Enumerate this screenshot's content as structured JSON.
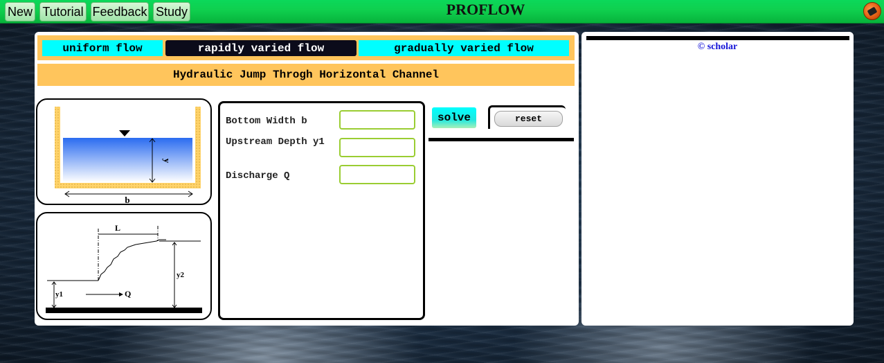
{
  "topbar": {
    "app_title": "PROFLOW",
    "nav": [
      "New",
      "Tutorial",
      "Feedback",
      "Study"
    ],
    "logout_icon": "logout-icon"
  },
  "tabs": [
    {
      "label": "uniform flow",
      "active": false
    },
    {
      "label": "rapidly varied flow",
      "active": true
    },
    {
      "label": "gradually varied flow",
      "active": false
    }
  ],
  "heading": "Hydraulic Jump Throgh Horizontal Channel",
  "diagram_cross_section": {
    "depth_label": "y",
    "width_label": "b"
  },
  "diagram_jump": {
    "length_label": "L",
    "y1_label": "y1",
    "y2_label": "y2",
    "discharge_label": "Q"
  },
  "form": {
    "fields": [
      {
        "label": "Bottom Width b",
        "value": ""
      },
      {
        "label": "Upstream Depth y1",
        "value": ""
      },
      {
        "label": "Discharge Q",
        "value": ""
      }
    ],
    "solve_label": "solve",
    "reset_label": "reset"
  },
  "output": {
    "copyright": "© scholar"
  },
  "colors": {
    "topbar": "#0fcf4e",
    "tab_strip": "#ffc55c",
    "tab": "#00ffff",
    "active_tab": "#0b0b1a",
    "input_border": "#9acd32",
    "copyright": "#1515d8"
  }
}
